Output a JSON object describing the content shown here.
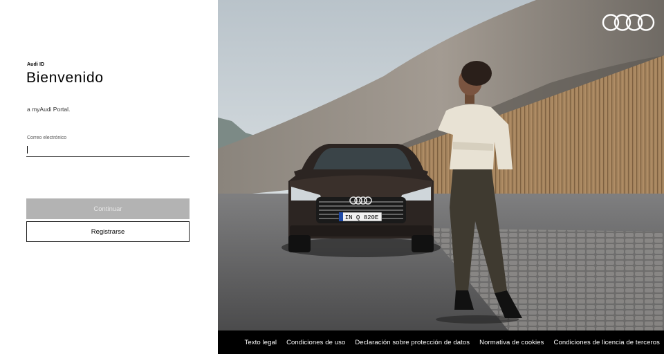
{
  "login": {
    "brand_label": "Audi ID",
    "title": "Bienvenido",
    "subtitle": "a myAudi Portal.",
    "email_label": "Correo electrónico",
    "email_value": "",
    "continue_label": "Continuar",
    "register_label": "Registrarse"
  },
  "hero": {
    "logo_icon": "audi-rings-logo",
    "license_plate": "IN Q 820E"
  },
  "footer": {
    "links": [
      "Texto legal",
      "Condiciones de uso",
      "Declaración sobre protección de datos",
      "Normativa de cookies",
      "Condiciones de licencia de terceros"
    ]
  },
  "colors": {
    "disabled_button": "#b3b3b3",
    "footer_bg": "#000000",
    "text": "#000000"
  }
}
